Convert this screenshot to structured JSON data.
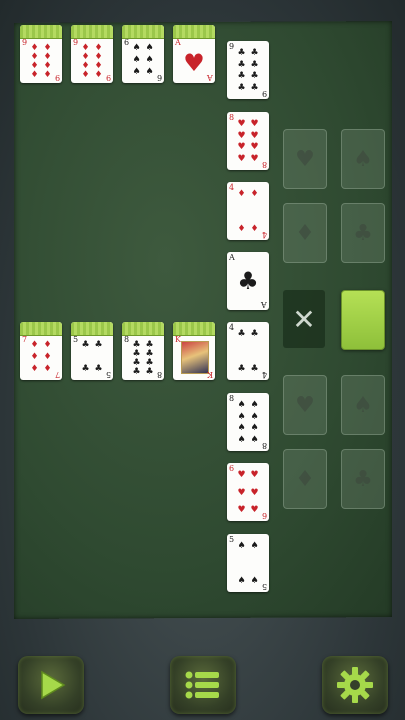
{
  "game": "Solitaire",
  "colors": {
    "accent": "#9bc74a",
    "felt": "#2f4a31",
    "red_suit": "#c8232a",
    "black_suit": "#1b1b1b"
  },
  "foundation_row_top": [
    {
      "rank": "9",
      "suit": "♦",
      "color": "red"
    },
    {
      "rank": "9",
      "suit": "♦",
      "color": "red"
    },
    {
      "rank": "6",
      "suit": "♠",
      "color": "black"
    },
    {
      "rank": "A",
      "suit": "♥",
      "color": "red"
    }
  ],
  "foundation_row_bottom": [
    {
      "rank": "7",
      "suit": "♦",
      "color": "red"
    },
    {
      "rank": "5",
      "suit": "♣",
      "color": "black"
    },
    {
      "rank": "8",
      "suit": "♣",
      "color": "black"
    },
    {
      "rank": "K",
      "suit": "♦",
      "color": "red"
    }
  ],
  "column": [
    {
      "rank": "9",
      "suit": "♣",
      "color": "black"
    },
    {
      "rank": "8",
      "suit": "♥",
      "color": "red"
    },
    {
      "rank": "4",
      "suit": "♦",
      "color": "red"
    },
    {
      "rank": "A",
      "suit": "♣",
      "color": "black"
    },
    {
      "rank": "4",
      "suit": "♣",
      "color": "black"
    },
    {
      "rank": "8",
      "suit": "♠",
      "color": "black"
    },
    {
      "rank": "6",
      "suit": "♥",
      "color": "red"
    },
    {
      "rank": "5",
      "suit": "♠",
      "color": "black"
    }
  ],
  "ghost_slots": [
    "♥",
    "♠",
    "♦",
    "♣",
    "♥",
    "♠",
    "♦",
    "♣"
  ],
  "discard_symbol": "✕",
  "buttons": {
    "play": "play-icon",
    "menu": "menu-icon",
    "settings": "gear-icon"
  }
}
